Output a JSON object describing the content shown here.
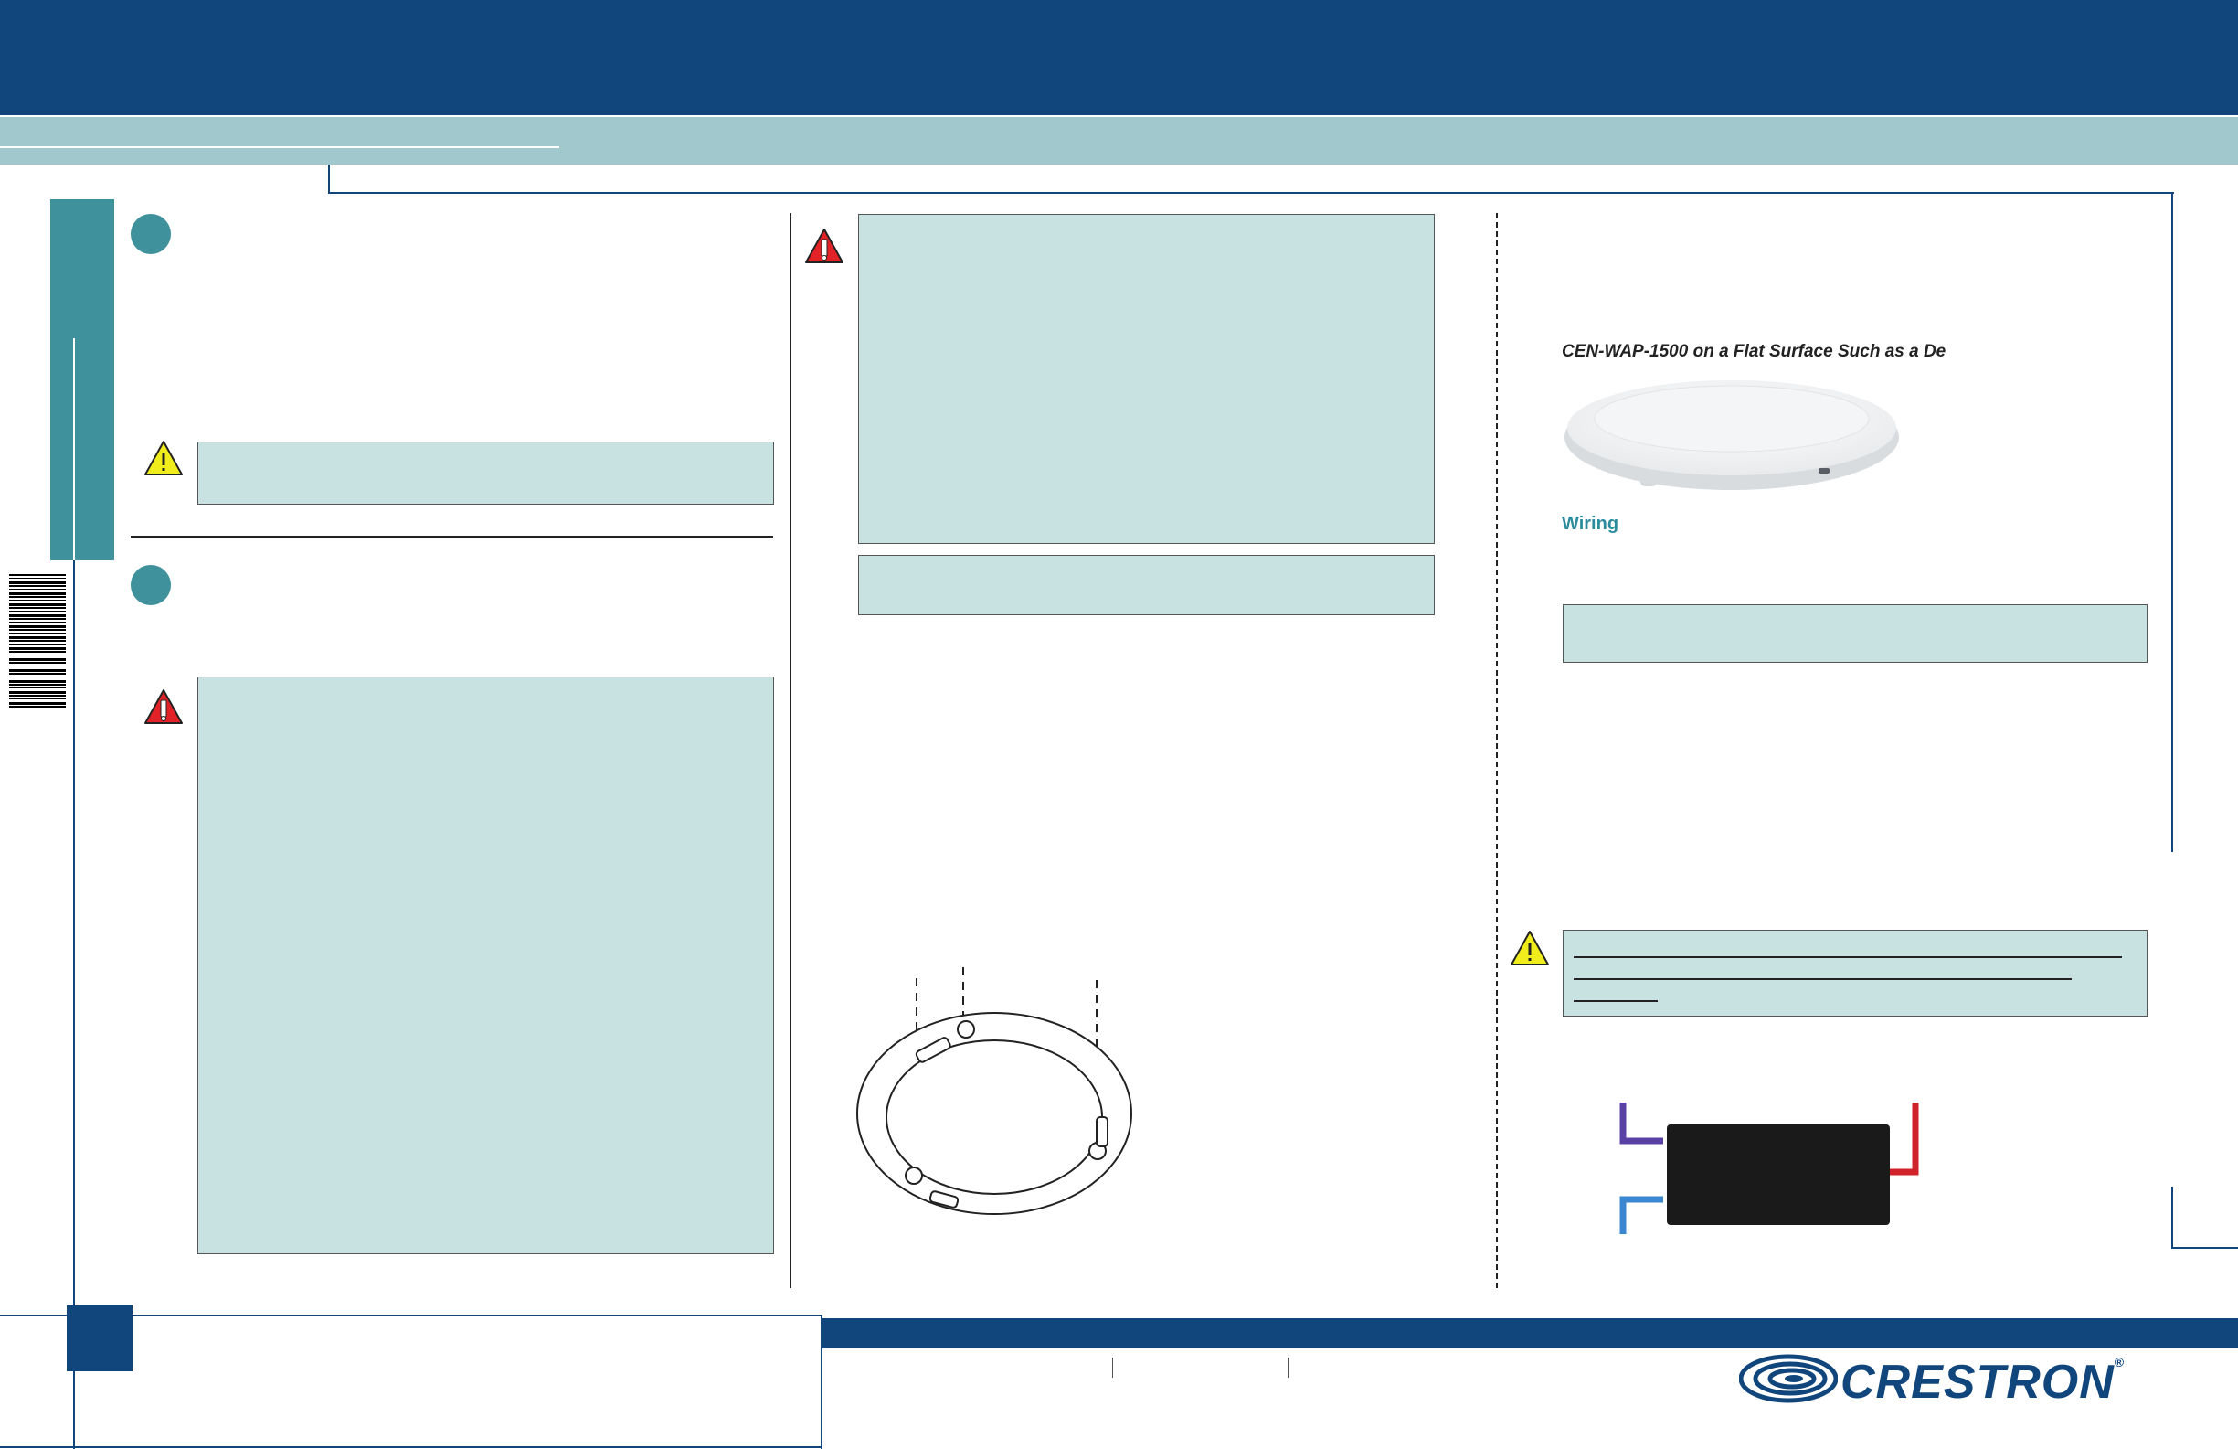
{
  "image_caption": "CEN-WAP-1500 on a Flat Surface Such as a De",
  "wiring_heading": "Wiring",
  "brand": {
    "name": "CRESTRON",
    "mark": "®"
  },
  "colors": {
    "header": "#11467c",
    "subheader": "#a1c8cc",
    "accent": "#3f929c",
    "note_fill": "#c8e2e2",
    "warning_red": "#e32228",
    "caution_yellow": "#f1ec1c",
    "wire_purple": "#5a3fa6",
    "wire_blue": "#3a86d0",
    "wire_red": "#d0222a"
  },
  "icons": {
    "step_markers": [
      "step-circle",
      "step-circle"
    ],
    "warnings": [
      "caution-triangle-icon",
      "warning-triangle-icon",
      "warning-triangle-icon",
      "caution-triangle-icon"
    ]
  }
}
